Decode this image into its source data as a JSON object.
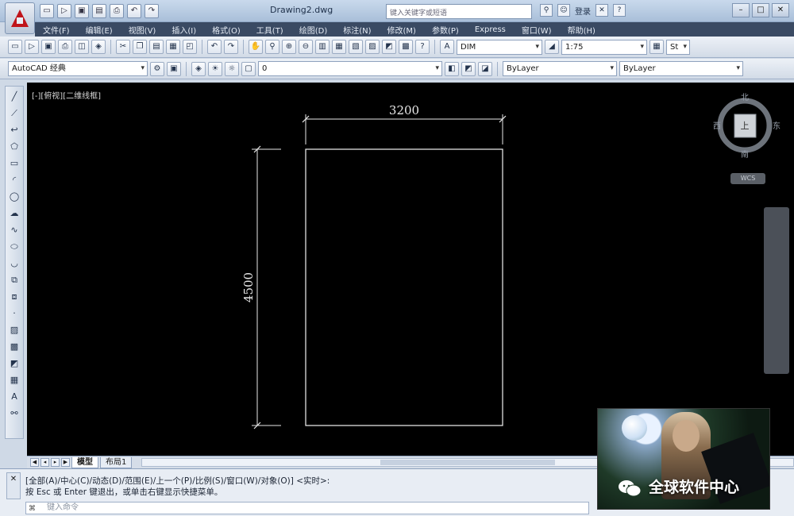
{
  "title_bar": {
    "document_title": "Drawing2.dwg",
    "search_placeholder": "键入关键字或短语",
    "login_label": "登录",
    "help_label": "?"
  },
  "quick_access": [
    "new-icon",
    "open-icon",
    "save-icon",
    "saveas-icon",
    "print-icon",
    "undo-icon",
    "redo-icon"
  ],
  "menu": [
    "文件(F)",
    "编辑(E)",
    "视图(V)",
    "插入(I)",
    "格式(O)",
    "工具(T)",
    "绘图(D)",
    "标注(N)",
    "修改(M)",
    "参数(P)",
    "Express",
    "窗口(W)",
    "帮助(H)"
  ],
  "toolbar": {
    "dim_style": "DIM",
    "scale": "1:75",
    "style_right": "St"
  },
  "toolbar2": {
    "workspace": "AutoCAD 经典",
    "layer": "0",
    "color": "ByLayer",
    "linetype": "ByLayer"
  },
  "canvas": {
    "viewport_label": "[-][俯视][二维线框]",
    "dim_horizontal": "3200",
    "dim_vertical": "4500",
    "compass": {
      "north": "北",
      "south": "南",
      "east": "东",
      "west": "西",
      "top": "上"
    },
    "wcs_label": "WCS",
    "background": "#000000"
  },
  "layout_tabs": [
    "模型",
    "布局1"
  ],
  "command": {
    "history": [
      "[全部(A)/中心(C)/动态(D)/范围(E)/上一个(P)/比例(S)/窗口(W)/对象(O)] <实时>:",
      "按 Esc 或 Enter 键退出，或单击右键显示快捷菜单。"
    ],
    "input_placeholder": "键入命令"
  },
  "watermark": {
    "text": "全球软件中心"
  },
  "colors": {
    "accent": "#c0151b",
    "chrome": "#d2dbe7",
    "menubar": "#3a4a63"
  }
}
